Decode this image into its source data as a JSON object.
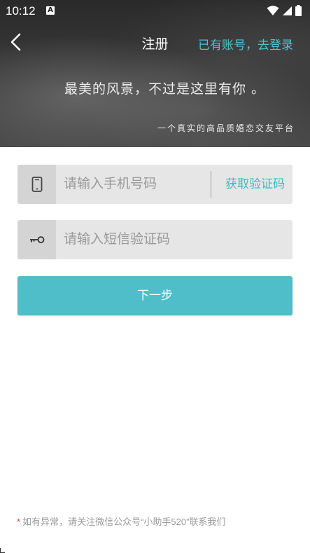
{
  "status_bar": {
    "time": "10:12",
    "notification_badge": "A",
    "icons": [
      "wifi-icon",
      "signal-icon",
      "battery-icon"
    ]
  },
  "header": {
    "back_icon": "chevron-left-icon",
    "title": "注册",
    "login_link": "已有账号，去登录"
  },
  "banner": {
    "slogan": "最美的风景，不过是这里有你 。",
    "subslogan": "一个真实的高品质婚恋交友平台"
  },
  "form": {
    "phone": {
      "icon": "phone-icon",
      "placeholder": "请输入手机号码",
      "value": "",
      "code_button": "获取验证码"
    },
    "sms": {
      "icon": "key-icon",
      "placeholder": "请输入短信验证码",
      "value": ""
    },
    "next_button": "下一步"
  },
  "footer": {
    "asterisk": "*",
    "note": "如有异常，请关注微信公众号“小助手520”联系我们"
  },
  "colors": {
    "accent": "#4fbec8",
    "link": "#4ec3ca",
    "field_bg": "#e6e6e6",
    "icon_box_bg": "#d4d4d4",
    "asterisk": "#e03a3a"
  }
}
